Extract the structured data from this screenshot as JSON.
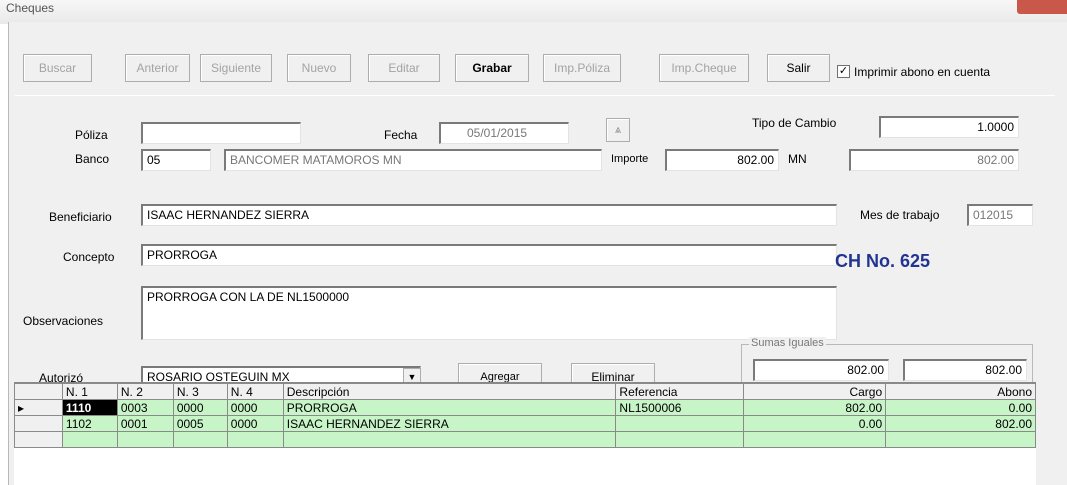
{
  "window": {
    "title": "Cheques"
  },
  "toolbar": {
    "buttons": [
      {
        "label": "Buscar",
        "enabled": false
      },
      {
        "label": "Anterior",
        "enabled": false
      },
      {
        "label": "Siguiente",
        "enabled": false
      },
      {
        "label": "Nuevo",
        "enabled": false
      },
      {
        "label": "Editar",
        "enabled": false
      },
      {
        "label": "Grabar",
        "enabled": true
      },
      {
        "label": "Imp.Póliza",
        "enabled": false
      },
      {
        "label": "Imp.Cheque",
        "enabled": false
      },
      {
        "label": "Salir",
        "enabled": true
      }
    ],
    "print_checkbox": {
      "label": "Imprimir abono en cuenta",
      "checked": true
    }
  },
  "form": {
    "poliza": {
      "label": "Póliza",
      "value": ""
    },
    "fecha": {
      "label": "Fecha",
      "value": "05/01/2015"
    },
    "tipo_cambio": {
      "label": "Tipo de Cambio",
      "value": "1.0000"
    },
    "banco": {
      "label": "Banco",
      "code": "05",
      "name": "BANCOMER MATAMOROS MN"
    },
    "importe": {
      "label": "Importe",
      "value": "802.00",
      "currency_label": "MN",
      "mn_value": "802.00"
    },
    "beneficiario": {
      "label": "Beneficiario",
      "value": "ISAAC HERNANDEZ SIERRA"
    },
    "mes_trabajo": {
      "label": "Mes de trabajo",
      "value": "012015"
    },
    "concepto": {
      "label": "Concepto",
      "value": "PRORROGA"
    },
    "check_number": "CH No. 625",
    "observaciones": {
      "label": "Observaciones",
      "value": "PRORROGA CON LA DE NL1500000"
    },
    "autorizo": {
      "label": "Autorizó",
      "value": "ROSARIO OSTEGUIN MX"
    },
    "agregar_label": "Agregar",
    "eliminar_label": "Eliminar",
    "sumas_iguales": {
      "title": "Sumas Iguales",
      "cargo": "802.00",
      "abono": "802.00"
    }
  },
  "grid": {
    "headers": [
      "N. 1",
      "N. 2",
      "N. 3",
      "N. 4",
      "Descripción",
      "Referencia",
      "Cargo",
      "Abono"
    ],
    "rows": [
      [
        "1110",
        "0003",
        "0000",
        "0000",
        "PRORROGA",
        "NL1500006",
        "802.00",
        "0.00"
      ],
      [
        "1102",
        "0001",
        "0005",
        "0000",
        "ISAAC HERNANDEZ SIERRA",
        "",
        "0.00",
        "802.00"
      ]
    ]
  }
}
